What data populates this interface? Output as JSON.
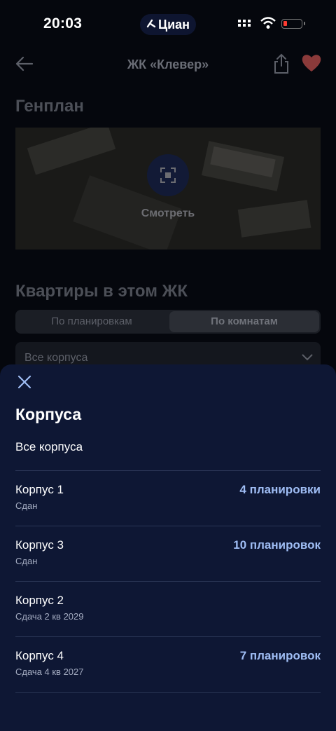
{
  "status_bar": {
    "time": "20:03",
    "app_pill": "Циан"
  },
  "header": {
    "title": "ЖК «Клевер»"
  },
  "genplan": {
    "heading": "Генплан",
    "view_label": "Смотреть"
  },
  "apartments": {
    "heading": "Квартиры в этом ЖК",
    "tabs": [
      {
        "label": "По планировкам"
      },
      {
        "label": "По комнатам"
      }
    ],
    "selected_tab": "По комнатам",
    "building_select": "Все корпуса"
  },
  "sheet": {
    "title": "Корпуса",
    "all_option": "Все корпуса",
    "items": [
      {
        "name": "Корпус 1",
        "status": "Сдан",
        "count": "4 планировки"
      },
      {
        "name": "Корпус 3",
        "status": "Сдан",
        "count": "10 планировок"
      },
      {
        "name": "Корпус 2",
        "status": "Сдача 2 кв 2029",
        "count": ""
      },
      {
        "name": "Корпус 4",
        "status": "Сдача 4 кв 2027",
        "count": "7 планировок"
      }
    ]
  },
  "colors": {
    "sheet_bg": "#0e1734",
    "accent_count": "#9fbdf4",
    "heart": "#8b3a3a",
    "battery_low": "#ff3b30"
  }
}
